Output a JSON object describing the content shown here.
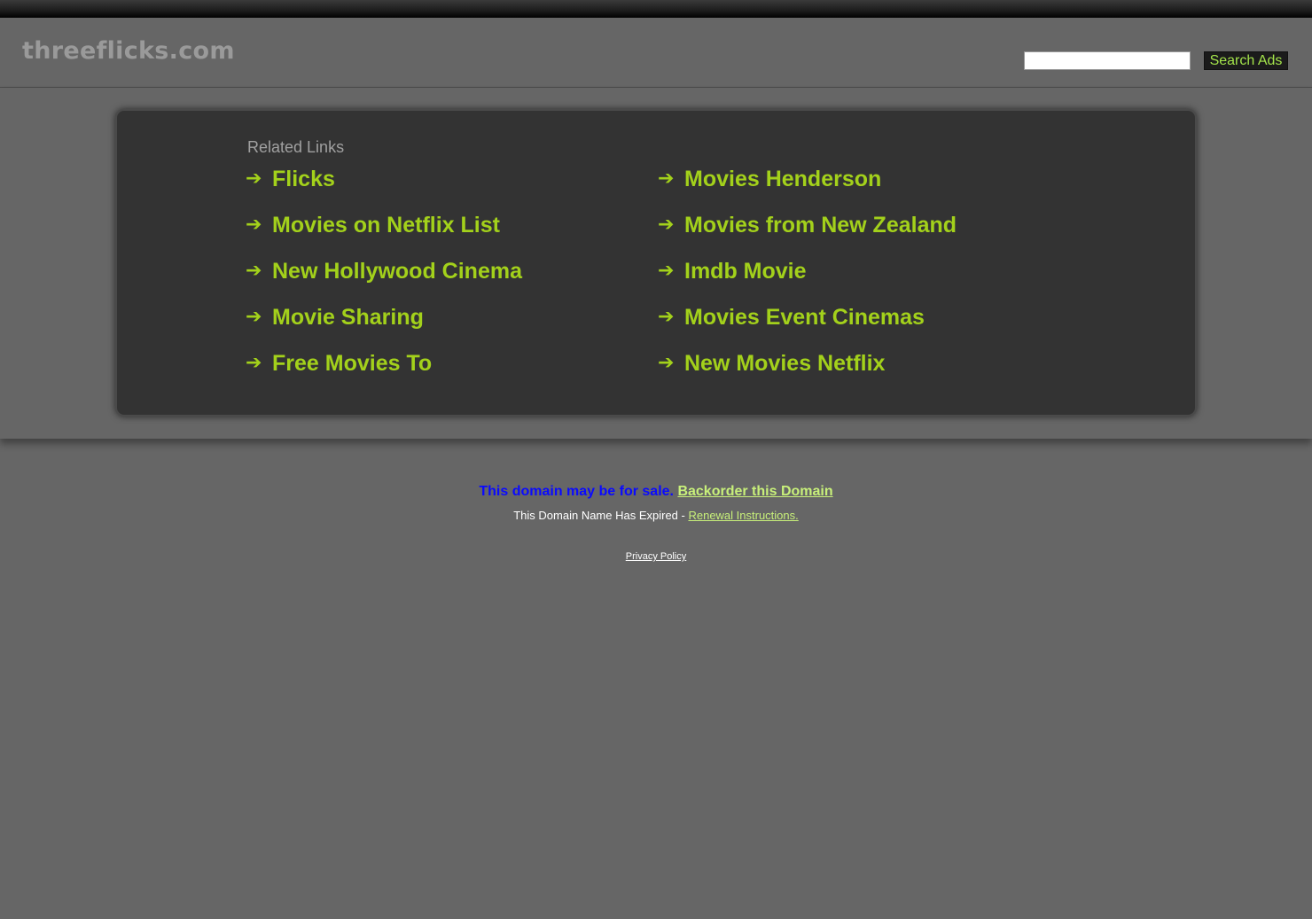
{
  "header": {
    "site_title": "threeflicks.com",
    "search_placeholder": "",
    "search_value": "",
    "search_button_label": "Search Ads"
  },
  "related": {
    "heading": "Related Links",
    "left_links": [
      {
        "label": "Flicks"
      },
      {
        "label": "Movies on Netflix List"
      },
      {
        "label": "New Hollywood Cinema"
      },
      {
        "label": "Movie Sharing"
      },
      {
        "label": "Free Movies To"
      }
    ],
    "right_links": [
      {
        "label": "Movies Henderson"
      },
      {
        "label": "Movies from New Zealand"
      },
      {
        "label": "Imdb Movie"
      },
      {
        "label": "Movies Event Cinemas"
      },
      {
        "label": "New Movies Netflix"
      }
    ],
    "arrow_glyph": "➔"
  },
  "footer": {
    "sale_text": "This domain may be for sale.",
    "backorder_label": "Backorder this Domain",
    "expired_text": "This Domain Name Has Expired - ",
    "renewal_label": "Renewal Instructions.",
    "privacy_label": "Privacy Policy"
  },
  "colors": {
    "background": "#666666",
    "panel": "#333333",
    "link_green": "#a3d11b",
    "sale_blue": "#0a0aff",
    "light_green": "#c8f07a"
  }
}
